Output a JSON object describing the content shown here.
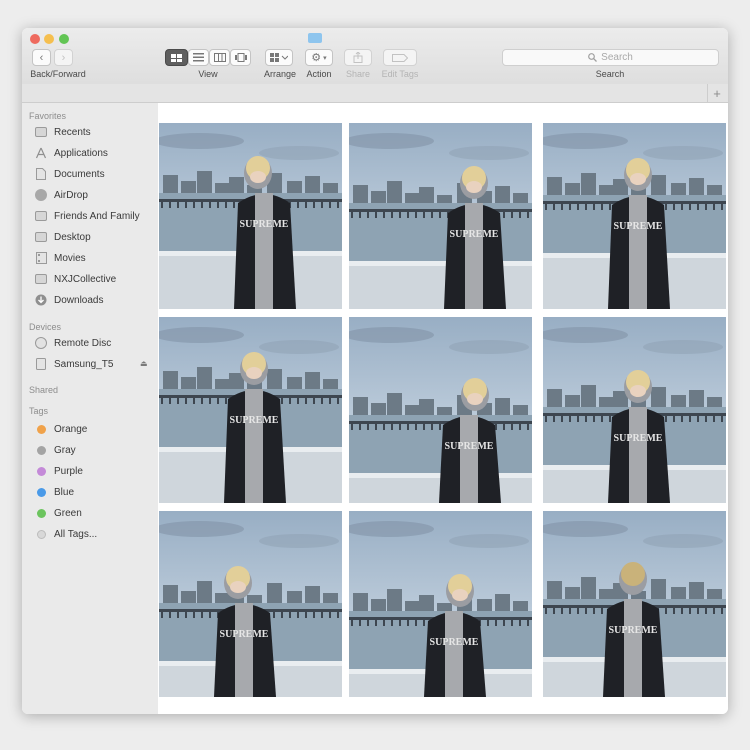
{
  "toolbar": {
    "nav_label": "Back/Forward",
    "view_label": "View",
    "arrange_label": "Arrange",
    "action_label": "Action",
    "share_label": "Share",
    "edit_tags_label": "Edit Tags",
    "search_label": "Search",
    "search_placeholder": "Search"
  },
  "sidebar": {
    "favorites_title": "Favorites",
    "favorites": [
      {
        "label": "Recents",
        "icon": "recents-icon"
      },
      {
        "label": "Applications",
        "icon": "applications-icon"
      },
      {
        "label": "Documents",
        "icon": "documents-icon"
      },
      {
        "label": "AirDrop",
        "icon": "airdrop-icon"
      },
      {
        "label": "Friends And Family",
        "icon": "folder-icon"
      },
      {
        "label": "Desktop",
        "icon": "desktop-icon"
      },
      {
        "label": "Movies",
        "icon": "movies-icon"
      },
      {
        "label": "NXJCollective",
        "icon": "folder-icon"
      },
      {
        "label": "Downloads",
        "icon": "downloads-icon"
      }
    ],
    "devices_title": "Devices",
    "devices": [
      {
        "label": "Remote Disc",
        "icon": "disc-icon"
      },
      {
        "label": "Samsung_T5",
        "icon": "drive-icon"
      }
    ],
    "shared_title": "Shared",
    "tags_title": "Tags",
    "tags": [
      {
        "label": "Orange",
        "color": "#f0a24a"
      },
      {
        "label": "Gray",
        "color": "#a4a4a4"
      },
      {
        "label": "Purple",
        "color": "#c48ad8"
      },
      {
        "label": "Blue",
        "color": "#4a9ae8"
      },
      {
        "label": "Green",
        "color": "#6cc45e"
      },
      {
        "label": "All Tags...",
        "color": "#d8d8d8"
      }
    ]
  },
  "photos": [
    {
      "name": "photo-1",
      "jacket": "SUPREME"
    },
    {
      "name": "photo-2",
      "jacket": "SUPREME"
    },
    {
      "name": "photo-3",
      "jacket": "SUPREME"
    },
    {
      "name": "photo-4",
      "jacket": "SUPREME"
    },
    {
      "name": "photo-5",
      "jacket": "SUPREME"
    },
    {
      "name": "photo-6",
      "jacket": "SUPREME"
    },
    {
      "name": "photo-7",
      "jacket": "SUPREME"
    },
    {
      "name": "photo-8",
      "jacket": "SUPREME"
    },
    {
      "name": "photo-9",
      "jacket": "SUPREME"
    }
  ]
}
